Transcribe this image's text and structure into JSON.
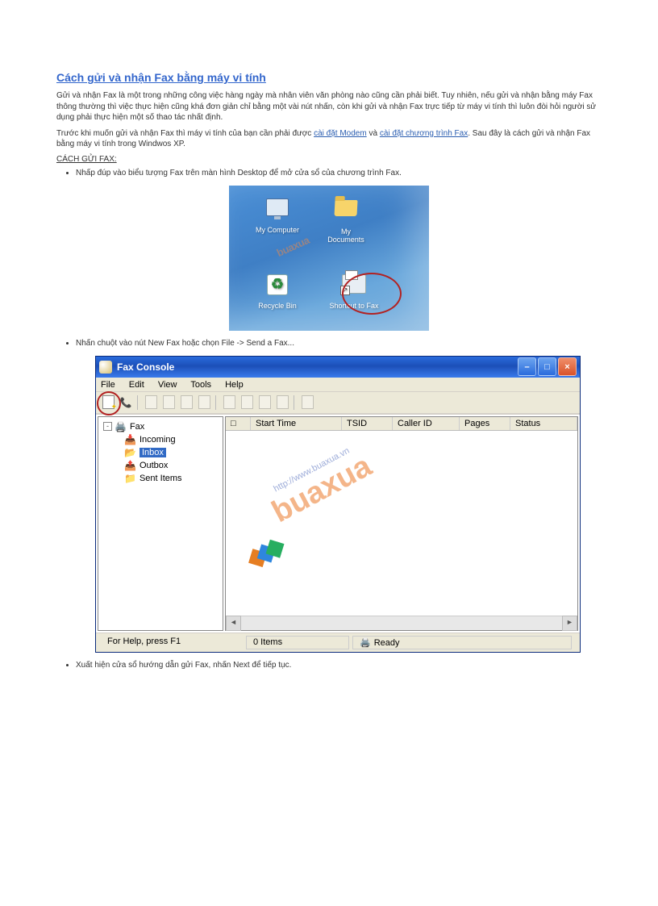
{
  "title": "Cách gửi và nhận Fax bằng máy vi tính",
  "para1": "Gửi và nhận Fax là một trong những công việc hàng ngày mà nhân viên văn phòng nào cũng cần phải biết. Tuy nhiên, nếu gửi và nhận bằng máy Fax thông thường thì việc thực hiện cũng khá đơn giản chỉ bằng một vài nút nhấn, còn khi gửi và nhận Fax trực tiếp từ máy vi tính thì luôn đòi hỏi người sử dụng phải thực hiện một số thao tác nhất định.",
  "para2_before": "Trước khi muốn gửi và nhận Fax thì máy vi tính của bạn cần phải được ",
  "link_modem": "cài đặt Modem",
  "para2_mid": " và ",
  "link_faxprog": "cài đặt chương trình Fax",
  "para2_after": ". Sau đây là cách gửi và nhận Fax bằng máy vi tính trong Windwos XP.",
  "section_head": "CÁCH GỬI FAX:",
  "bullet1": "Nhấp đúp vào biểu tượng Fax trên màn hình Desktop để mở cửa sổ của chương trình Fax.",
  "bullet2": "Nhấn chuột vào nút New Fax hoặc chọn File -> Send a Fax...",
  "bullet3": "Xuất hiện cửa sổ hướng dẫn gửi Fax, nhấn Next để tiếp tục.",
  "desktop": {
    "mycomputer": "My Computer",
    "mydocuments": "My Documents",
    "recyclebin": "Recycle Bin",
    "shortcut": "Shortcut to Fax",
    "watermark": "buaxua"
  },
  "faxconsole": {
    "title": "Fax Console",
    "menu": {
      "file": "File",
      "edit": "Edit",
      "view": "View",
      "tools": "Tools",
      "help": "Help"
    },
    "tree": {
      "root": "Fax",
      "incoming": "Incoming",
      "inbox": "Inbox",
      "outbox": "Outbox",
      "sent": "Sent Items"
    },
    "columns": {
      "icon": "□",
      "start": "Start Time",
      "tsid": "TSID",
      "caller": "Caller ID",
      "pages": "Pages",
      "status": "Status"
    },
    "status": {
      "help": "For Help, press F1",
      "items": "0 Items",
      "ready": "Ready"
    },
    "watermark_url": "http://www.buaxua.vn",
    "watermark_text": "buaxua"
  }
}
